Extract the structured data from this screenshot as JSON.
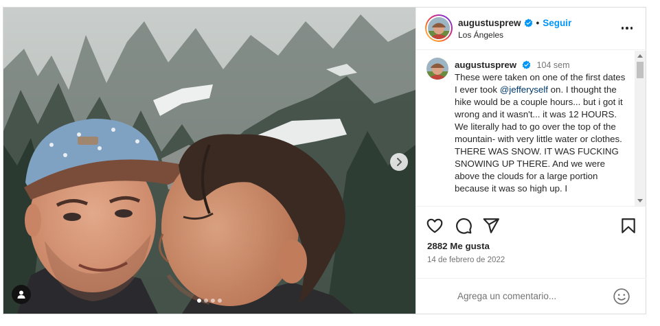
{
  "post": {
    "username": "augustusprew",
    "verified": true,
    "separator": "•",
    "follow_label": "Seguir",
    "location": "Los Ángeles",
    "more_icon": "more-horizontal-icon"
  },
  "caption": {
    "username": "augustusprew",
    "time": "104 sem",
    "text_before_mention": "These were taken on one of the first dates I ever took ",
    "mention": "@jefferyself",
    "text_after_mention": " on. I thought the hike would be a couple hours... but i got it wrong and it wasn't... it was 12 HOURS. We literally had to go over the top of the mountain- with very little water or clothes. THERE WAS SNOW. IT WAS FUCKING SNOWING UP THERE. And we were above the clouds for a large portion because it was so high up. I"
  },
  "actions": {
    "like_icon": "heart-icon",
    "comment_icon": "comment-icon",
    "share_icon": "share-icon",
    "save_icon": "bookmark-icon"
  },
  "likes_text": "2882 Me gusta",
  "date_text": "14 de febrero de 2022",
  "comment_box": {
    "placeholder": "Agrega un comentario...",
    "emoji_icon": "emoji-icon"
  },
  "carousel": {
    "slide_count": 4,
    "active_index": 0
  },
  "colors": {
    "accent_blue": "#0095f6",
    "mention_blue": "#00376b",
    "text": "#262626",
    "secondary_text": "#737373"
  }
}
